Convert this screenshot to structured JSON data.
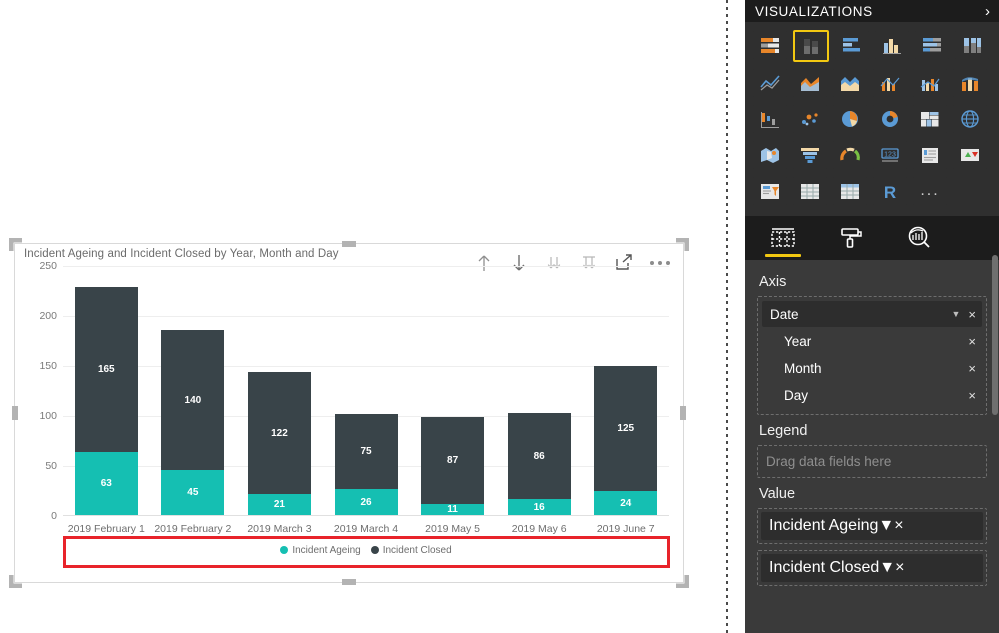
{
  "visual": {
    "title": "Incident Ageing and Incident Closed by Year, Month and Day",
    "toolbar": {
      "drill_up": "drill-up",
      "drill_down": "drill-down",
      "expand_next_level": "expand-next-level",
      "expand_all": "expand-all-down-one-level",
      "focus_mode": "focus-mode",
      "more_options": "more-options"
    }
  },
  "chart_data": {
    "type": "bar",
    "stacked": true,
    "title": "Incident Ageing and Incident Closed by Year, Month and Day",
    "xlabel": "",
    "ylabel": "",
    "ylim": [
      0,
      250
    ],
    "yticks": [
      0,
      50,
      100,
      150,
      200,
      250
    ],
    "ytick_labels": [
      "0",
      "50",
      "100",
      "150",
      "200",
      "250"
    ],
    "grid": true,
    "legend_position": "bottom",
    "categories": [
      "2019 February 1",
      "2019 February 2",
      "2019 March 3",
      "2019 March 4",
      "2019 May 5",
      "2019 May 6",
      "2019 June 7"
    ],
    "series": [
      {
        "name": "Incident Ageing",
        "color": "#15bfb2",
        "values": [
          63,
          45,
          21,
          26,
          11,
          16,
          24
        ]
      },
      {
        "name": "Incident Closed",
        "color": "#394449",
        "values": [
          165,
          140,
          122,
          75,
          87,
          86,
          125
        ]
      }
    ],
    "totals": [
      228,
      185,
      143,
      101,
      98,
      102,
      149
    ],
    "annotations": [
      {
        "type": "highlight-rectangle",
        "color": "#e8232a",
        "target": "x-axis-category-labels"
      }
    ]
  },
  "panel": {
    "title": "VISUALIZATIONS",
    "collapse_icon": "chevron-right-icon",
    "gallery": {
      "selected_index": 1,
      "items": [
        "stacked-bar-chart-icon",
        "stacked-column-chart-icon",
        "clustered-bar-chart-icon",
        "clustered-column-chart-icon",
        "100-percent-stacked-bar-chart-icon",
        "100-percent-stacked-column-chart-icon",
        "line-chart-icon",
        "area-chart-icon",
        "stacked-area-chart-icon",
        "line-and-stacked-column-chart-icon",
        "line-and-clustered-column-chart-icon",
        "ribbon-chart-icon",
        "waterfall-chart-icon",
        "scatter-chart-icon",
        "pie-chart-icon",
        "donut-chart-icon",
        "treemap-icon",
        "map-icon",
        "filled-map-icon",
        "funnel-icon",
        "gauge-icon",
        "card-icon",
        "multi-row-card-icon",
        "kpi-icon",
        "slicer-icon",
        "table-icon",
        "matrix-icon",
        "r-script-visual-icon",
        "more-visuals-icon"
      ],
      "more_label": "..."
    },
    "tabs": [
      {
        "name": "fields-tab",
        "icon": "fields-table-icon",
        "active": true
      },
      {
        "name": "format-tab",
        "icon": "paint-roller-icon",
        "active": false
      },
      {
        "name": "analytics-tab",
        "icon": "analytics-magnifier-icon",
        "active": false
      }
    ],
    "axis": {
      "label": "Axis",
      "items": [
        {
          "name": "Date",
          "level": 0,
          "has_dropdown": true,
          "remove": "×"
        },
        {
          "name": "Year",
          "level": 1,
          "has_dropdown": false,
          "remove": "×"
        },
        {
          "name": "Month",
          "level": 1,
          "has_dropdown": false,
          "remove": "×"
        },
        {
          "name": "Day",
          "level": 1,
          "has_dropdown": false,
          "remove": "×"
        }
      ]
    },
    "legend": {
      "label": "Legend",
      "placeholder": "Drag data fields here"
    },
    "value": {
      "label": "Value",
      "items": [
        {
          "name": "Incident Ageing",
          "has_dropdown": true,
          "remove": "×"
        },
        {
          "name": "Incident Closed",
          "has_dropdown": true,
          "remove": "×"
        }
      ]
    }
  },
  "colors": {
    "series_ageing": "#15bfb2",
    "series_closed": "#394449",
    "accent_yellow": "#f2c811",
    "highlight_red": "#e8232a",
    "panel_bg": "#3a3a3a",
    "panel_dark": "#1c1c1c"
  }
}
